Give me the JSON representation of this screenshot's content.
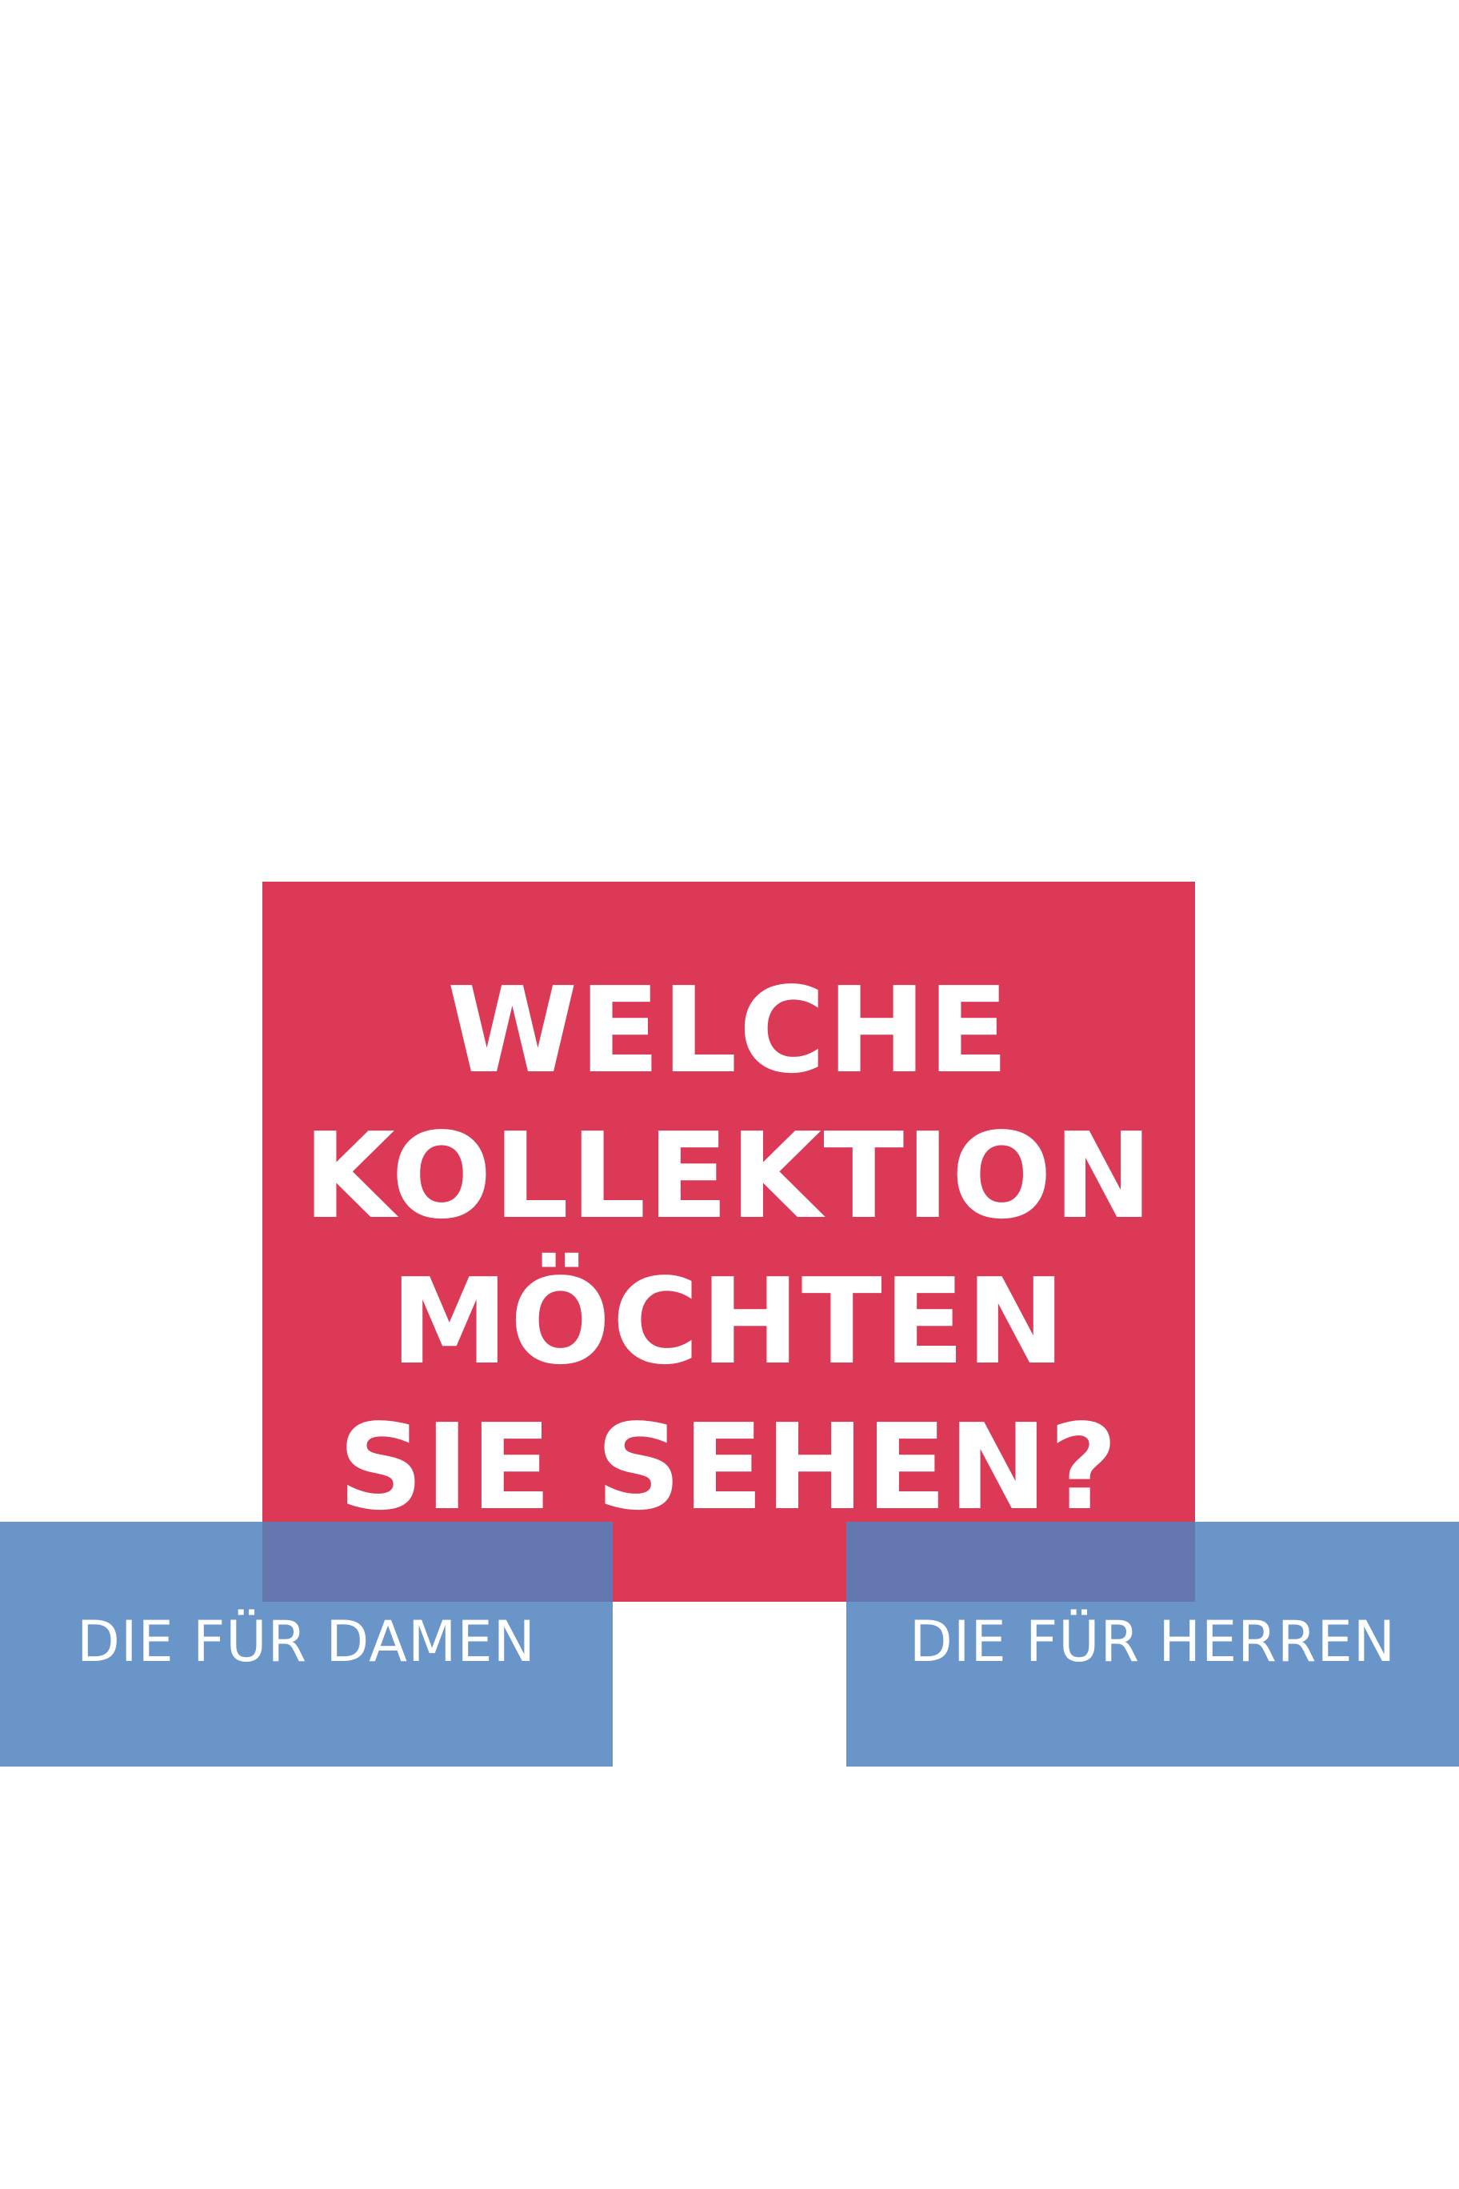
{
  "question": {
    "lines": [
      "WELCHE",
      "KOLLEKTION",
      "MÖCHTEN",
      "SIE SEHEN?"
    ]
  },
  "choices": {
    "damen": {
      "label": "DIE FÜR DAMEN"
    },
    "herren": {
      "label": "DIE FÜR HERREN"
    }
  },
  "colors": {
    "question_box": "#dc3956",
    "choice_box": "#6a92c4",
    "overlap": "#742072",
    "text": "#ffffff",
    "background": "#ffffff"
  }
}
